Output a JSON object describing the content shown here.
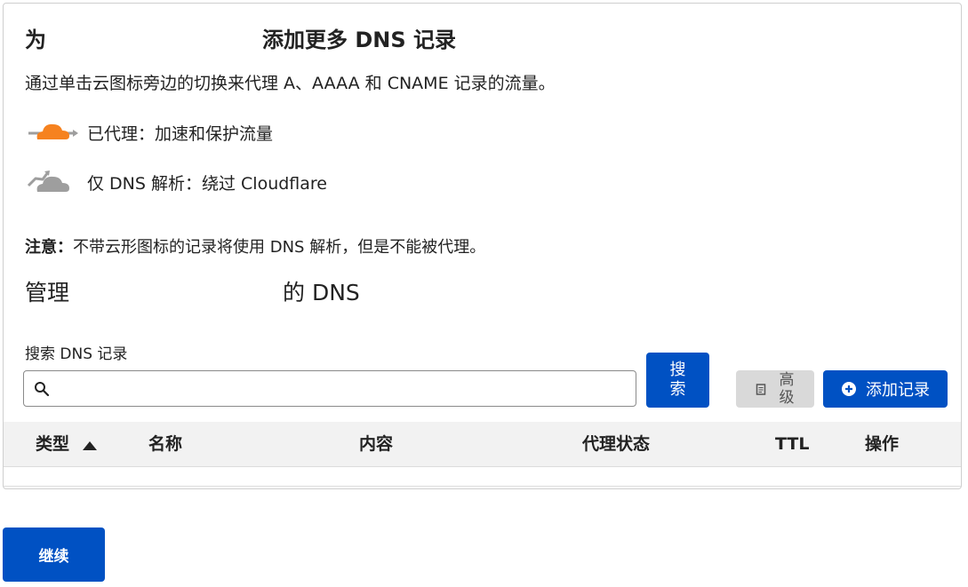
{
  "title": {
    "prefix": "为",
    "main": "添加更多 DNS 记录"
  },
  "description": "通过单击云图标旁边的切换来代理 A、AAAA 和 CNAME 记录的流量。",
  "legend": {
    "proxied": {
      "icon": "orange-cloud-proxied-icon",
      "color": "#f6821f",
      "label": "已代理：加速和保护流量"
    },
    "dns_only": {
      "icon": "gray-cloud-dns-only-icon",
      "color": "#9e9e9e",
      "label": "仅 DNS 解析：绕过 Cloudflare"
    }
  },
  "note": {
    "label": "注意：",
    "text": "不带云形图标的记录将使用 DNS 解析，但是不能被代理。"
  },
  "manage": {
    "prefix": "管理",
    "suffix": "的 DNS"
  },
  "search": {
    "label": "搜索 DNS 记录",
    "placeholder": "",
    "value": "",
    "icon": "search-icon",
    "button_label": "搜索"
  },
  "actions": {
    "advanced_label": "高级",
    "advanced_icon": "document-icon",
    "add_label": "添加记录",
    "add_icon": "plus-circle-icon"
  },
  "table": {
    "columns": [
      "类型",
      "名称",
      "内容",
      "代理状态",
      "TTL",
      "操作"
    ],
    "sort_icon": "sort-ascending-icon",
    "rows": []
  },
  "footer": {
    "continue_label": "继续"
  },
  "colors": {
    "primary": "#0051c3",
    "secondary_button": "#d9d9d9",
    "table_header_bg": "#f2f2f2"
  }
}
